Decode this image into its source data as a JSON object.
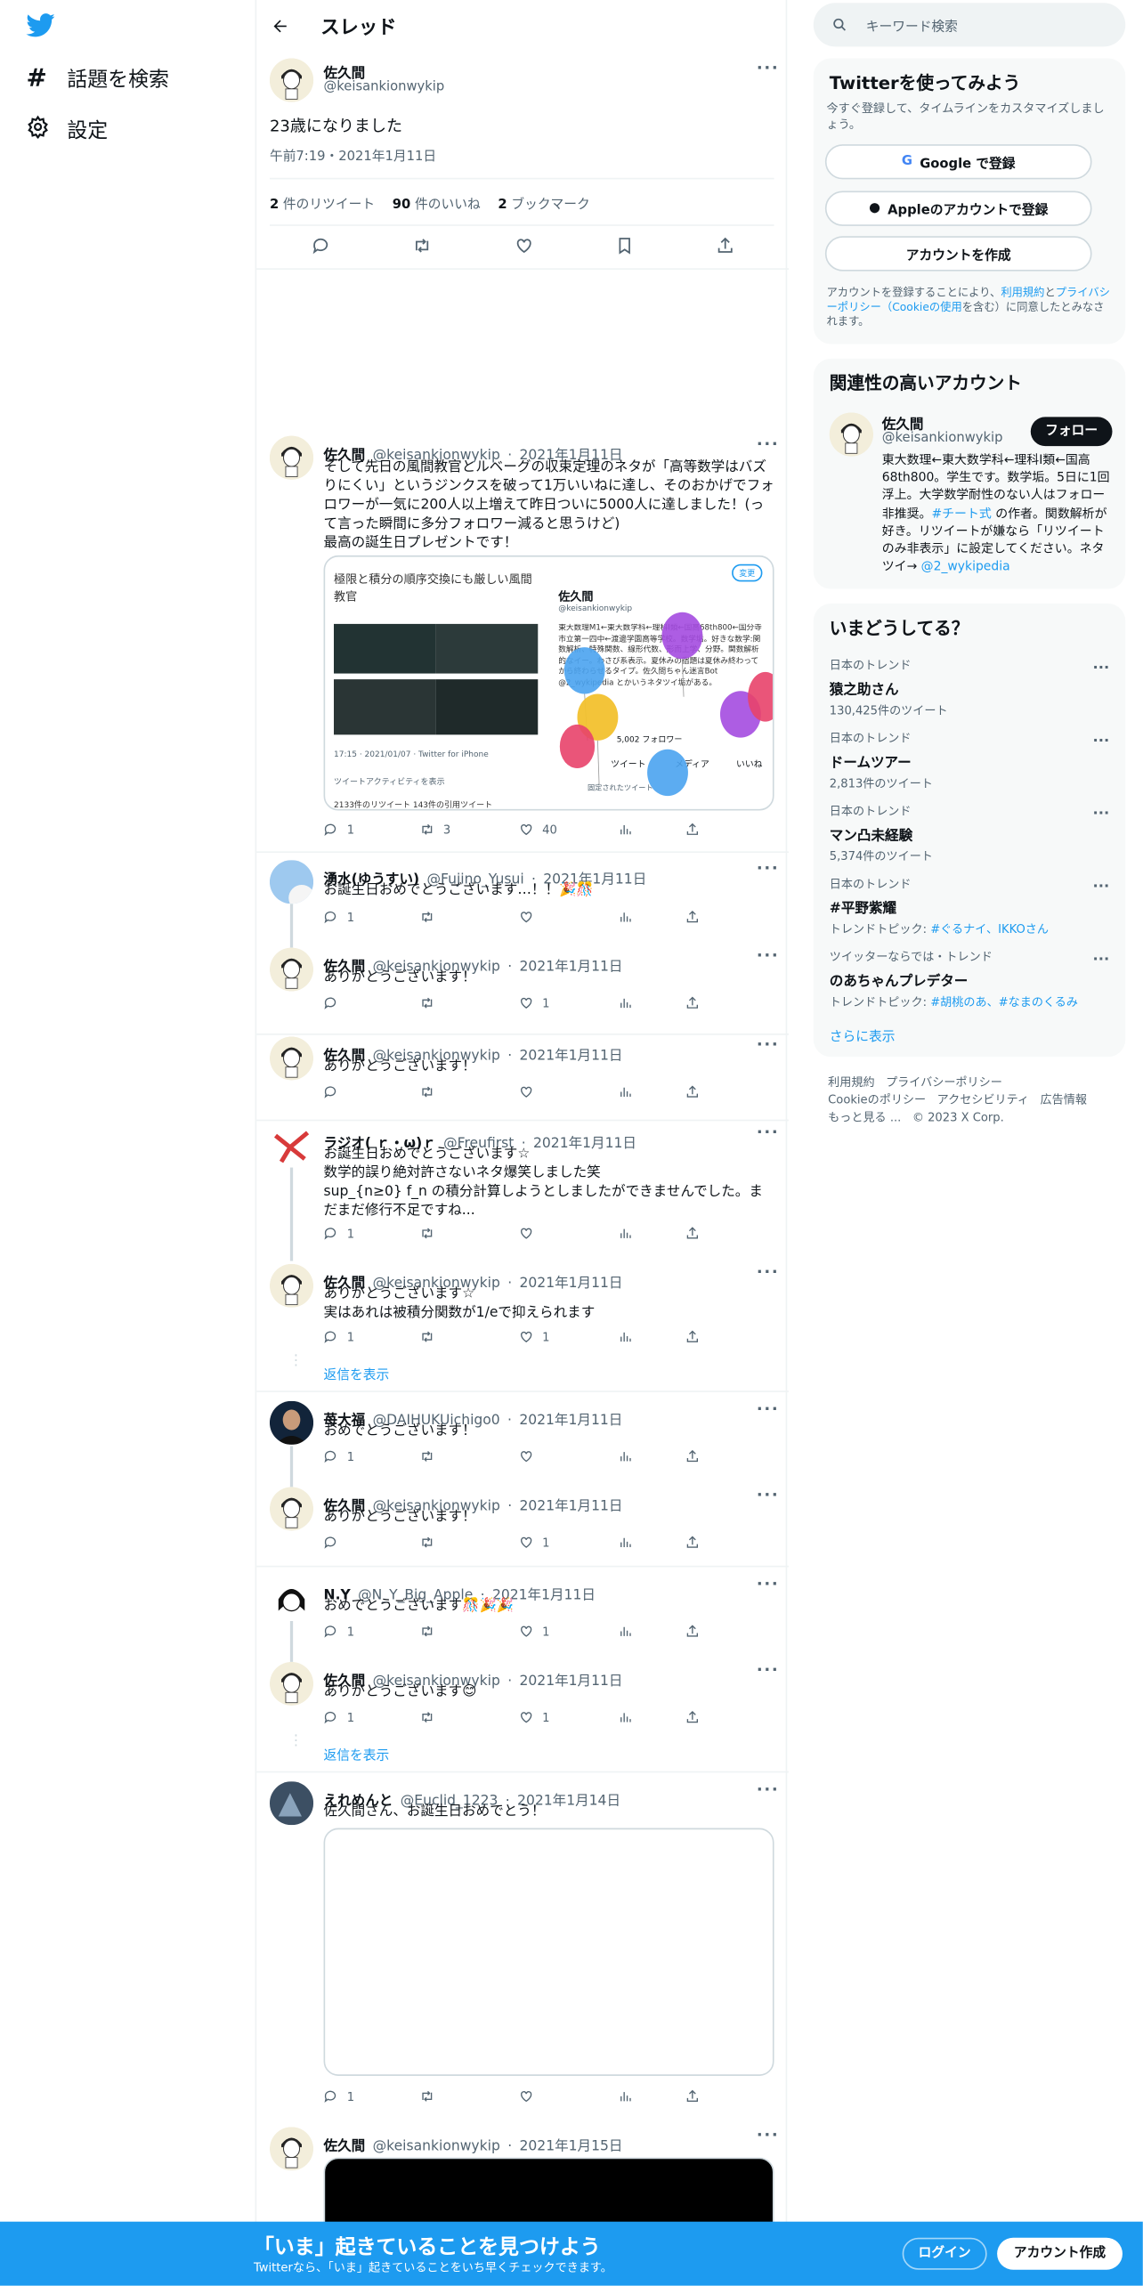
{
  "nav": {
    "explore_label": "話題を検索",
    "settings_label": "設定"
  },
  "header": {
    "title": "スレッド"
  },
  "main_tweet": {
    "display_name": "佐久間",
    "handle": "@keisankionwykip",
    "text": "23歳になりました",
    "timestamp": "午前7:19・2021年1月11日",
    "retweets_count": "2",
    "retweets_label": "件のリツイート",
    "likes_count": "90",
    "likes_label": "件のいいね",
    "bookmarks_count": "2",
    "bookmarks_label": "ブックマーク"
  },
  "self_reply": {
    "display_name": "佐久間",
    "handle": "@keisankionwykip",
    "date": "2021年1月11日",
    "text": "そして先日の風間教官とルベーグの収束定理のネタが「高等数学はバズりにくい」というジンクスを破って1万いいねに達し、そのおかげでフォロワーが一気に200人以上増えて昨日ついに5000人に達しました！(って言った瞬間に多分フォロワー減ると思うけど)\n最高の誕生日プレゼントです！",
    "reply_count": "1",
    "retweet_count": "3",
    "like_count": "40",
    "image": {
      "left_title": "極限と積分の順序交換にも厳しい風間教官",
      "left_time": "17:15 · 2021/01/07 · Twitter for iPhone",
      "left_activity": "ツイートアクティビティを表示",
      "left_stats": "2133件のリツイート 143件の引用ツイート",
      "right_name": "佐久間",
      "right_handle": "@keisankionwykip",
      "right_bio": "東大数理M1←東大数学科←理科I類←国高68th800←国分寺市立第一四中←渡邊学園高等学校。数学垢。好きな数学:関数解析、特殊関数、線形代数、形而上学、分野。関数解析的なイー。わさび系表示。夏休みの宿題は夏休み終わってから終わらせるタイプ。佐久間ちゃん迷言Bot @2_wykipedia とかいうネタツイ垢がある。",
      "right_followers": "5,002 フォロワー",
      "right_tab_tweets": "ツイート",
      "right_tab_media": "メディア",
      "right_tab_likes": "いいね",
      "right_pinned": "固定されたツイート",
      "right_edit": "変更"
    }
  },
  "replies": [
    {
      "display_name": "湧水(ゆうすい)",
      "handle": "@Fujino_Yusui",
      "date": "2021年1月11日",
      "text": "お誕生日おめでとうございます…！！🎉🎊",
      "reply": "1",
      "retweet": "",
      "like": ""
    },
    {
      "display_name": "佐久間",
      "handle": "@keisankionwykip",
      "date": "2021年1月11日",
      "text": "ありがとうございます！",
      "reply": "",
      "retweet": "",
      "like": "1"
    },
    {
      "display_name": "佐久間",
      "handle": "@keisankionwykip",
      "date": "2021年1月11日",
      "text": "ありがとうございます！",
      "reply": "",
      "retweet": "",
      "like": ""
    },
    {
      "display_name": "ラジオ( ｒ・ω)ｒ",
      "handle": "@Freufirst",
      "date": "2021年1月11日",
      "text": "お誕生日おめでとうございます☆\n数学的誤り絶対許さないネタ爆笑しました笑\nsup_{n≥0} f_n の積分計算しようとしましたができませんでした。まだまだ修行不足ですね...",
      "reply": "1",
      "retweet": "",
      "like": ""
    },
    {
      "display_name": "佐久間",
      "handle": "@keisankionwykip",
      "date": "2021年1月11日",
      "text": "ありがとうございます☆\n実はあれは被積分関数が1/eで抑えられます",
      "reply": "1",
      "retweet": "",
      "like": "1"
    },
    {
      "display_name": "苺大福",
      "handle": "@DAIHUKUichigo0",
      "date": "2021年1月11日",
      "text": "おめでとうございます！",
      "reply": "1",
      "retweet": "",
      "like": ""
    },
    {
      "display_name": "佐久間",
      "handle": "@keisankionwykip",
      "date": "2021年1月11日",
      "text": "ありがとうございます！",
      "reply": "",
      "retweet": "",
      "like": "1"
    },
    {
      "display_name": "N.Y",
      "handle": "@N_Y_Big_Apple",
      "date": "2021年1月11日",
      "text": "おめでとうございます🎊🎉🎉",
      "reply": "1",
      "retweet": "",
      "like": "1"
    },
    {
      "display_name": "佐久間",
      "handle": "@keisankionwykip",
      "date": "2021年1月11日",
      "text": "ありがとうございます😊",
      "reply": "1",
      "retweet": "",
      "like": "1"
    },
    {
      "display_name": "えれめんと",
      "handle": "@Euclid_1223",
      "date": "2021年1月14日",
      "text": "佐久間さん、お誕生日おめでとう！",
      "reply": "1",
      "retweet": "",
      "like": ""
    },
    {
      "display_name": "佐久間",
      "handle": "@keisankionwykip",
      "date": "2021年1月15日",
      "text": "",
      "reply": "",
      "retweet": "",
      "like": ""
    }
  ],
  "show_replies_label": "返信を表示",
  "search": {
    "placeholder": "キーワード検索"
  },
  "signup": {
    "title": "Twitterを使ってみよう",
    "subtitle": "今すぐ登録して、タイムラインをカスタマイズしましょう。",
    "google_label": "Google で登録",
    "apple_label": "Appleのアカウントで登録",
    "create_label": "アカウントを作成",
    "terms_prefix": "アカウントを登録することにより、",
    "terms_link": "利用規約",
    "terms_and": "と",
    "privacy_link": "プライバシーポリシー",
    "cookie_link": "（Cookieの使用",
    "terms_suffix": "を含む）に同意したとみなされます。"
  },
  "related": {
    "title": "関連性の高いアカウント",
    "display_name": "佐久間",
    "handle": "@keisankionwykip",
    "follow_label": "フォロー",
    "bio_1": "東大数理←東大数学科←理科I類←国高68th800。学生です。数学垢。5日に1回浮上。大学数学耐性のない人はフォロー非推奨。",
    "bio_hashtag": "#チート式",
    "bio_2": " の作者。関数解析が好き。リツイートが嫌なら「リツイートのみ非表示」に設定してください。ネタツイ→ ",
    "bio_link": "@2_wykipedia"
  },
  "trends": {
    "title": "いまどうしてる？",
    "items": [
      {
        "context": "日本のトレンド",
        "name": "猿之助さん",
        "count": "130,425件のツイート",
        "topic_prefix": "",
        "topic_links": ""
      },
      {
        "context": "日本のトレンド",
        "name": "ドームツアー",
        "count": "2,813件のツイート",
        "topic_prefix": "",
        "topic_links": ""
      },
      {
        "context": "日本のトレンド",
        "name": "マン凸未経験",
        "count": "5,374件のツイート",
        "topic_prefix": "",
        "topic_links": ""
      },
      {
        "context": "日本のトレンド",
        "name": "#平野紫耀",
        "count": "",
        "topic_prefix": "トレンドトピック: ",
        "topic_links": "#ぐるナイ、IKKOさん"
      },
      {
        "context": "ツイッターならでは・トレンド",
        "name": "のあちゃんプレデター",
        "count": "",
        "topic_prefix": "トレンドトピック: ",
        "topic_links": "#胡桃のあ、#なまのくるみ"
      }
    ],
    "show_more": "さらに表示"
  },
  "footer": {
    "terms": "利用規約",
    "privacy": "プライバシーポリシー",
    "cookie": "Cookieのポリシー",
    "accessibility": "アクセシビリティ",
    "ads": "広告情報",
    "more": "もっと見る ...",
    "copyright": "© 2023 X Corp."
  },
  "bottom_bar": {
    "title": "「いま」起きていることを見つけよう",
    "subtitle": "Twitterなら、「いま」起きていることをいち早くチェックできます。",
    "login_label": "ログイン",
    "signup_label": "アカウント作成"
  },
  "colors": {
    "accent": "#1d9bf0",
    "text": "#0f1419",
    "muted": "#536471"
  }
}
